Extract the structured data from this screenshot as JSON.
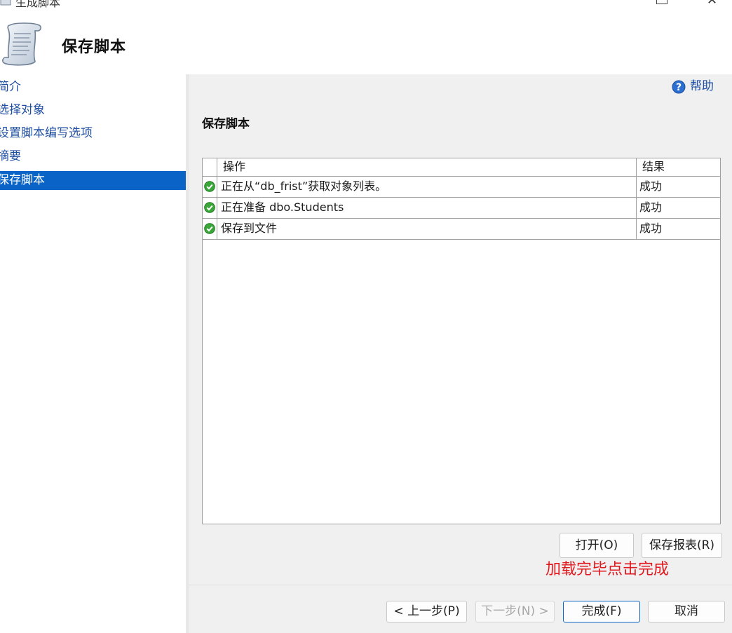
{
  "window": {
    "title": "生成脚本"
  },
  "header": {
    "title": "保存脚本",
    "icon": "scroll-icon"
  },
  "sidebar": {
    "items": [
      {
        "label": "简介"
      },
      {
        "label": "选择对象"
      },
      {
        "label": "设置脚本编写选项"
      },
      {
        "label": "摘要"
      },
      {
        "label": "保存脚本"
      }
    ],
    "active_index": 4
  },
  "help": {
    "label": "帮助",
    "icon": "help-icon"
  },
  "section": {
    "title": "保存脚本"
  },
  "table": {
    "columns": [
      "操作",
      "结果"
    ],
    "rows": [
      {
        "action": "正在从“db_frist”获取对象列表。",
        "result": "成功",
        "icon": "success-check-icon"
      },
      {
        "action": "正在准备 dbo.Students",
        "result": "成功",
        "icon": "success-check-icon"
      },
      {
        "action": "保存到文件",
        "result": "成功",
        "icon": "success-check-icon"
      }
    ]
  },
  "actions": {
    "open": "打开(O)",
    "save_report": "保存报表(R)"
  },
  "annotation": "加载完毕点击完成",
  "footer": {
    "prev": "< 上一步(P)",
    "next": "下一步(N) >",
    "finish": "完成(F)",
    "cancel": "取消"
  },
  "colors": {
    "accent": "#0a64c8",
    "link": "#1f4fa0",
    "success": "#3aa63a",
    "annotation": "#e0191e",
    "panel": "#f0f0f0"
  }
}
